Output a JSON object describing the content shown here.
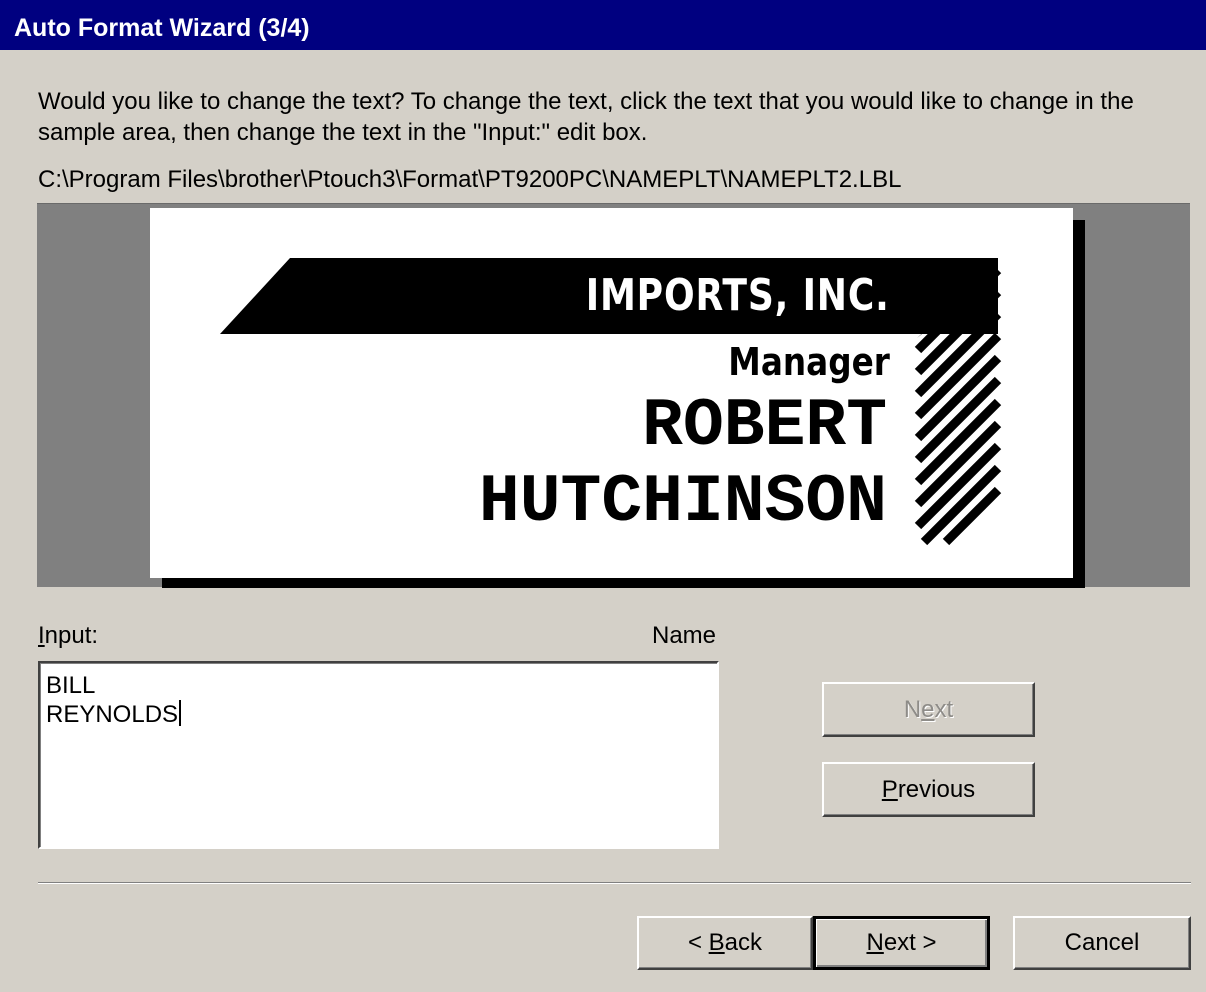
{
  "window": {
    "title": "Auto Format Wizard (3/4)"
  },
  "instruction": "Would you like to change the text? To change the text, click the text that you would like to change in the sample area, then change the text in the \"Input:\" edit box.",
  "file_path": "C:\\Program Files\\brother\\Ptouch3\\Format\\PT9200PC\\NAMEPLT\\NAMEPLT2.LBL",
  "label": {
    "company": "IMPORTS, INC.",
    "title": "Manager",
    "first_name": "ROBERT",
    "last_name": "HUTCHINSON"
  },
  "input": {
    "label_accel": "I",
    "label_rest": "nput:",
    "field_name": "Name",
    "lines": [
      "BILL",
      "REYNOLDS"
    ]
  },
  "side_buttons": {
    "next_label_pre": "N",
    "next_label_accel": "e",
    "next_label_post": "xt",
    "next_disabled": true,
    "previous_accel": "P",
    "previous_rest": "revious"
  },
  "footer_buttons": {
    "back_pre": "< ",
    "back_accel": "B",
    "back_post": "ack",
    "next_accel": "N",
    "next_post": "ext >",
    "cancel": "Cancel"
  },
  "colors": {
    "titlebar": "#000080",
    "dialog_bg": "#d4d0c8",
    "sample_bg": "#808080"
  }
}
